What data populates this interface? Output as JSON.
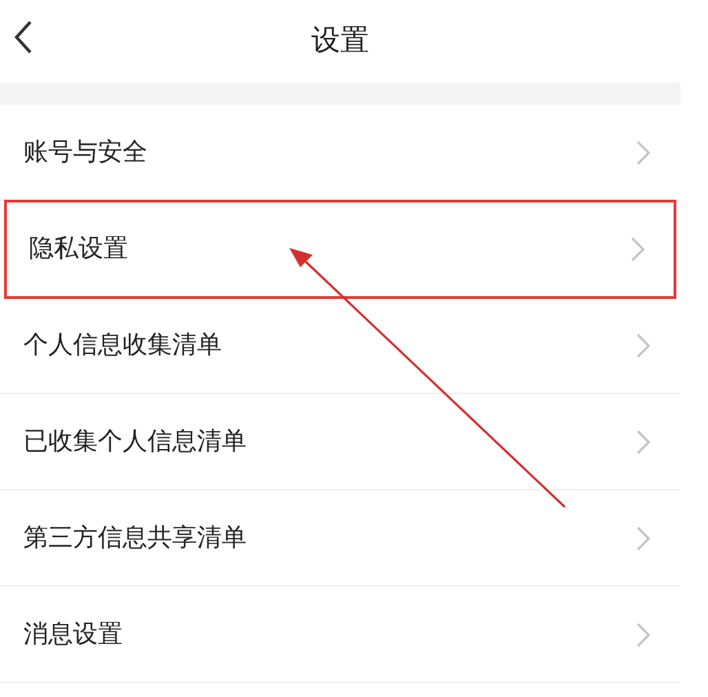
{
  "header": {
    "title": "设置"
  },
  "items": [
    {
      "label": "账号与安全",
      "highlighted": false
    },
    {
      "label": "隐私设置",
      "highlighted": true
    },
    {
      "label": "个人信息收集清单",
      "highlighted": false
    },
    {
      "label": "已收集个人信息清单",
      "highlighted": false
    },
    {
      "label": "第三方信息共享清单",
      "highlighted": false
    },
    {
      "label": "消息设置",
      "highlighted": false
    }
  ]
}
